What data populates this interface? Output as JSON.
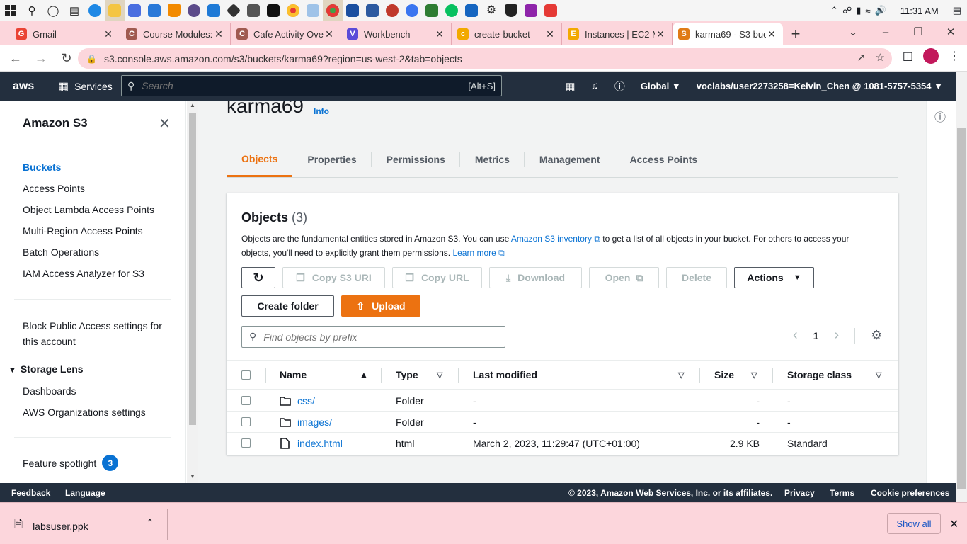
{
  "taskbar": {
    "clock": "11:31 AM"
  },
  "tabs": [
    {
      "title": "Gmail",
      "fav_color": "#ea4335",
      "fav_text": "G"
    },
    {
      "title": "Course Modules:",
      "fav_color": "#a05a50",
      "fav_text": "C"
    },
    {
      "title": "Cafe Activity Ove",
      "fav_color": "#a05a50",
      "fav_text": "C"
    },
    {
      "title": "Workbench",
      "fav_color": "#5b4bd8",
      "fav_text": "V"
    },
    {
      "title": "create-bucket —",
      "fav_color": "#f2a900",
      "fav_text": "c"
    },
    {
      "title": "Instances | EC2 M",
      "fav_color": "#f2a900",
      "fav_text": "E"
    },
    {
      "title": "karma69 - S3 buc",
      "fav_color": "#e07b16",
      "fav_text": "S"
    }
  ],
  "address": {
    "url": "s3.console.aws.amazon.com/s3/buckets/karma69?region=us-west-2&tab=objects"
  },
  "aws_header": {
    "logo": "aws",
    "services": "Services",
    "search_placeholder": "Search",
    "search_shortcut": "[Alt+S]",
    "region": "Global",
    "account": "voclabs/user2273258=Kelvin_Chen @ 1081-5757-5354"
  },
  "sidebar": {
    "title": "Amazon S3",
    "items": [
      "Buckets",
      "Access Points",
      "Object Lambda Access Points",
      "Multi-Region Access Points",
      "Batch Operations",
      "IAM Access Analyzer for S3"
    ],
    "block_public_1": "Block Public Access settings for",
    "block_public_2": "this account",
    "storage_lens": "Storage Lens",
    "lens_items": [
      "Dashboards",
      "AWS Organizations settings"
    ],
    "feature_spotlight": "Feature spotlight",
    "feature_count": "3"
  },
  "main": {
    "bucket_name": "karma69",
    "info": "Info",
    "tabs": [
      "Objects",
      "Properties",
      "Permissions",
      "Metrics",
      "Management",
      "Access Points"
    ],
    "objects_title": "Objects",
    "objects_count": "(3)",
    "desc_1": "Objects are the fundamental entities stored in Amazon S3. You can use ",
    "desc_link": "Amazon S3 inventory",
    "desc_2": " to get a list of all objects in your bucket. For others to access your objects, you'll need to explicitly grant them permissions. ",
    "learn_more": "Learn more",
    "buttons": {
      "copy_uri": "Copy S3 URI",
      "copy_url": "Copy URL",
      "download": "Download",
      "open": "Open",
      "delete": "Delete",
      "actions": "Actions",
      "create_folder": "Create folder",
      "upload": "Upload"
    },
    "find_placeholder": "Find objects by prefix",
    "page": "1",
    "columns": [
      "Name",
      "Type",
      "Last modified",
      "Size",
      "Storage class"
    ],
    "rows": [
      {
        "name": "css/",
        "type": "Folder",
        "modified": "-",
        "size": "-",
        "class": "-",
        "icon": "folder"
      },
      {
        "name": "images/",
        "type": "Folder",
        "modified": "-",
        "size": "-",
        "class": "-",
        "icon": "folder"
      },
      {
        "name": "index.html",
        "type": "html",
        "modified": "March 2, 2023, 11:29:47 (UTC+01:00)",
        "size": "2.9 KB",
        "class": "Standard",
        "icon": "file"
      }
    ]
  },
  "footer": {
    "feedback": "Feedback",
    "language": "Language",
    "copyright": "© 2023, Amazon Web Services, Inc. or its affiliates.",
    "privacy": "Privacy",
    "terms": "Terms",
    "cookies": "Cookie preferences"
  },
  "download_bar": {
    "file": "labsuser.ppk",
    "show_all": "Show all"
  }
}
